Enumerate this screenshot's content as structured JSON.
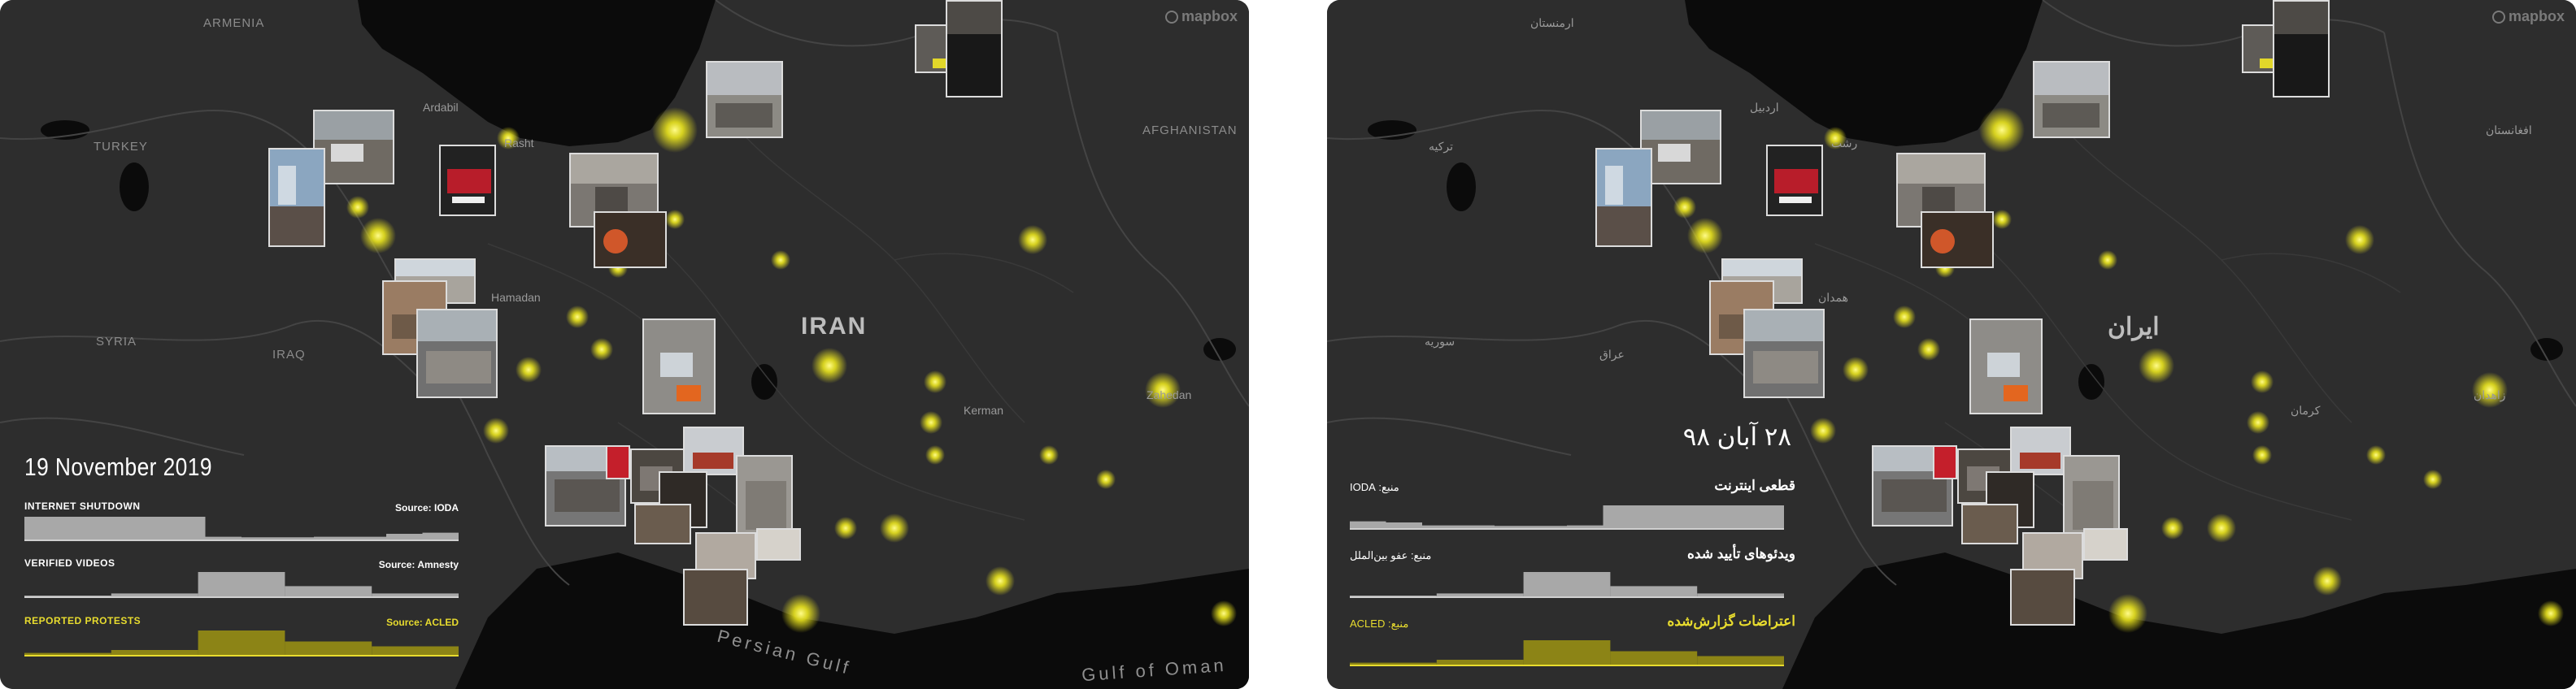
{
  "colors": {
    "panel_bg": "#222222",
    "land": "#2e2e2e",
    "water": "#0c0c0c",
    "border": "#3c3c3c",
    "glow": "#f5ef1e",
    "bar_grey": "#a8a8a8",
    "bar_yellow": "#8c8416",
    "text_yellow": "#e8dc2e"
  },
  "watermark": "mapbox",
  "panels": [
    {
      "language": "English",
      "date": "19 November 2019",
      "map_labels": {
        "armenia": "ARMENIA",
        "turkey": "TURKEY",
        "syria": "SYRIA",
        "iraq": "IRAQ",
        "afghanistan": "AFGHANISTAN",
        "iran": "IRAN",
        "ardabil": "Ardabil",
        "rasht": "Rasht",
        "hamadan": "Hamadan",
        "kerman": "Kerman",
        "zahedan": "Zahedan",
        "persian_gulf": "Persian Gulf",
        "gulf_of_oman": "Gulf of Oman"
      },
      "indicators": [
        {
          "label": "INTERNET SHUTDOWN",
          "source": "Source: IODA",
          "color": "grey"
        },
        {
          "label": "VERIFIED VIDEOS",
          "source": "Source: Amnesty",
          "color": "grey"
        },
        {
          "label": "REPORTED PROTESTS",
          "source": "Source: ACLED",
          "color": "yellow"
        }
      ]
    },
    {
      "language": "Persian",
      "date": "۲۸ آبان ۹۸",
      "map_labels": {
        "armenia": "ارمنستان",
        "turkey": "ترکیه",
        "syria": "سوریه",
        "iraq": "عراق",
        "afghanistan": "افغانستان",
        "iran": "ایران",
        "ardabil": "اردبیل",
        "rasht": "رشت",
        "hamadan": "همدان",
        "kerman": "کرمان",
        "zahedan": "زاهدان",
        "persian_gulf": "",
        "gulf_of_oman": ""
      },
      "indicators": [
        {
          "label": "قطعی اینترنت",
          "source": "منبع: IODA",
          "color": "grey"
        },
        {
          "label": "ویدئوهای تأیید شده",
          "source": "منبع: عفو بین‌الملل",
          "color": "grey"
        },
        {
          "label": "اعتراضات گزارش‌شده",
          "source": "منبع: ACLED",
          "color": "yellow"
        }
      ]
    }
  ],
  "chart_data": [
    {
      "type": "area",
      "series": [
        {
          "name": "INTERNET SHUTDOWN",
          "values": [
            1.0,
            1.0,
            1.0,
            1.0,
            1.0,
            0.12,
            0.1,
            0.1,
            0.12,
            0.12,
            0.25,
            0.3
          ]
        }
      ]
    },
    {
      "type": "bar",
      "series": [
        {
          "name": "VERIFIED VIDEOS",
          "values": [
            0,
            0.12,
            1.0,
            0.42,
            0.12
          ]
        }
      ]
    },
    {
      "type": "bar",
      "series": [
        {
          "name": "REPORTED PROTESTS",
          "values": [
            0.08,
            0.2,
            1.0,
            0.55,
            0.35
          ]
        }
      ]
    }
  ]
}
